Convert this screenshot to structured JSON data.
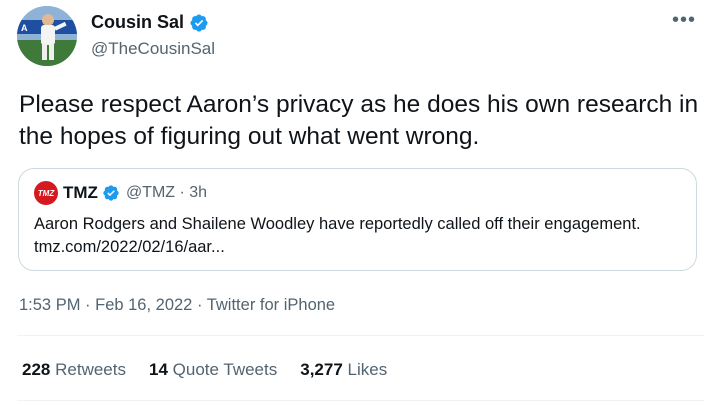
{
  "author": {
    "name": "Cousin Sal",
    "handle": "@TheCousinSal"
  },
  "tweet": {
    "text": "Please respect Aaron’s privacy as he does his own research in the hopes of figuring out what went wrong."
  },
  "quoted": {
    "logo_text": "TMZ",
    "name": "TMZ",
    "handle_time": "@TMZ · 3h",
    "text": "Aaron Rodgers and Shailene Woodley have reportedly called off their engagement. tmz.com/2022/02/16/aar..."
  },
  "meta": {
    "text": "1:53 PM · Feb 16, 2022 · Twitter for iPhone"
  },
  "stats": {
    "retweets_count": "228",
    "retweets_label": "Retweets",
    "quotes_count": "14",
    "quotes_label": "Quote Tweets",
    "likes_count": "3,277",
    "likes_label": "Likes"
  },
  "more_icon": "more-horizontal-icon",
  "verified_icon": "verified-badge-icon",
  "colors": {
    "verified": "#1d9bf0",
    "secondary_text": "#536471",
    "tmz_red": "#d6181f"
  }
}
